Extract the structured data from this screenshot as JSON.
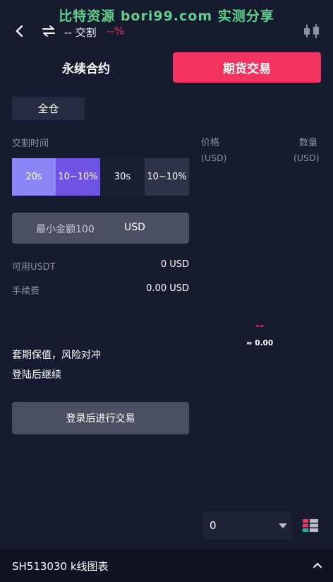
{
  "watermark": "比特资源 bori99.com 实测分享",
  "header": {
    "symbol": "-- 交割",
    "change": "--%"
  },
  "tabs": {
    "perpetual": "永续合约",
    "futures": "期货交易"
  },
  "margin_mode": "全仓",
  "settlement": {
    "label": "交割时间",
    "options": [
      {
        "label": "20s",
        "selected": true
      },
      {
        "label": "10~10%",
        "selected": true
      },
      {
        "label": "30s",
        "selected": false
      },
      {
        "label": "10~10%",
        "selected": false
      }
    ]
  },
  "orderbook": {
    "price_label": "价格",
    "price_unit": "(USD)",
    "qty_label": "数量",
    "qty_unit": "(USD)",
    "mid_price": "--",
    "mid_approx": "≈ 0.00"
  },
  "amount": {
    "placeholder": "最小金额100",
    "unit": "USD"
  },
  "available": {
    "label": "可用USDT",
    "value": "0 USD"
  },
  "fee": {
    "label": "手续费",
    "value": "0.00 USD"
  },
  "notes": [
    "套期保值，风险对冲",
    "登陆后继续"
  ],
  "login_button": "登录后进行交易",
  "depth": {
    "value": "0"
  },
  "bottom": {
    "title": "SH513030  k线图表"
  },
  "colors": {
    "accent": "#f2345f",
    "background": "#161b30",
    "seg_selected": "#8a86f6"
  }
}
